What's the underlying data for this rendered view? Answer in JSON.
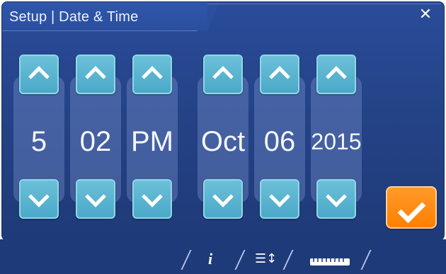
{
  "header": {
    "title": "Setup | Date & Time",
    "close_symbol": "✕"
  },
  "controls": {
    "up_symbol": "^",
    "down_symbol": "v",
    "confirm_icon": "checkmark-icon"
  },
  "date_time": {
    "hour": "5",
    "minute": "02",
    "meridiem": "PM",
    "month": "Oct",
    "day": "06",
    "year": "2015"
  },
  "footer": {
    "icons": [
      "info-icon",
      "sort-list-icon",
      "ruler-icon"
    ],
    "info_glyph": "i",
    "list_glyph": "☰↕"
  },
  "colors": {
    "panel": "#244387",
    "button": "#4aa9c8",
    "confirm": "#ff7f00",
    "text": "#f3f7ff"
  }
}
